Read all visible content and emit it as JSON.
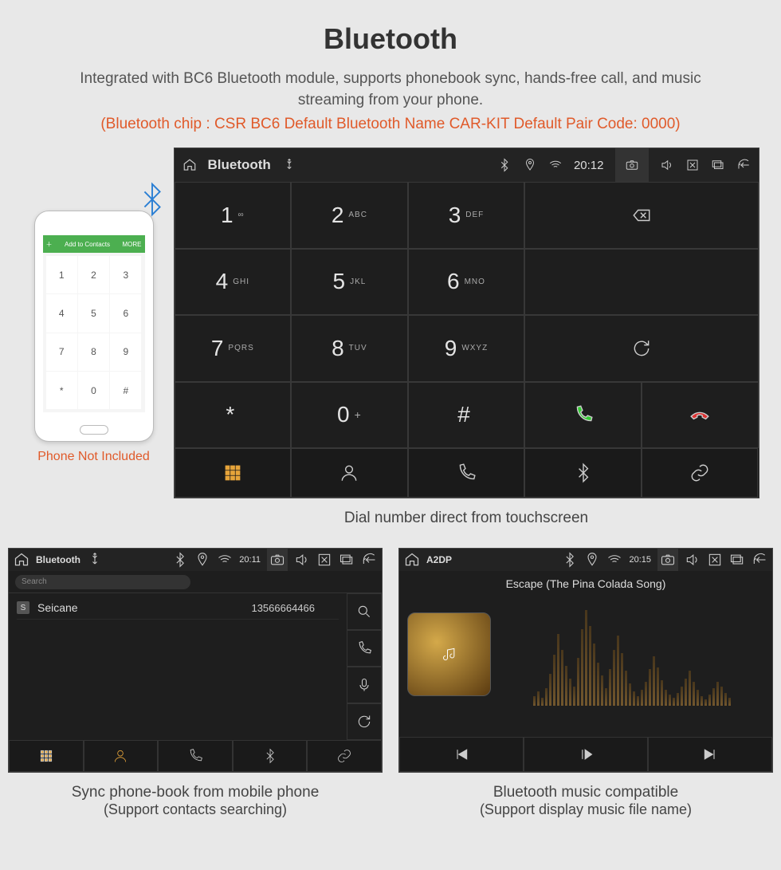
{
  "header": {
    "title": "Bluetooth",
    "subtitle": "Integrated with BC6 Bluetooth module, supports phonebook sync, hands-free call, and music streaming from your phone.",
    "specs": "(Bluetooth chip : CSR BC6     Default Bluetooth Name CAR-KIT     Default Pair Code: 0000)"
  },
  "phone": {
    "top_label": "Add to Contacts",
    "top_right": "MORE",
    "keys": [
      "1",
      "2",
      "3",
      "4",
      "5",
      "6",
      "7",
      "8",
      "9",
      "*",
      "0",
      "#"
    ],
    "caption": "Phone Not Included"
  },
  "dialer": {
    "statusbar": {
      "title": "Bluetooth",
      "time": "20:12"
    },
    "keys": [
      {
        "d": "1",
        "s": "∞"
      },
      {
        "d": "2",
        "s": "ABC"
      },
      {
        "d": "3",
        "s": "DEF"
      },
      {
        "d": "4",
        "s": "GHI"
      },
      {
        "d": "5",
        "s": "JKL"
      },
      {
        "d": "6",
        "s": "MNO"
      },
      {
        "d": "7",
        "s": "PQRS"
      },
      {
        "d": "8",
        "s": "TUV"
      },
      {
        "d": "9",
        "s": "WXYZ"
      },
      {
        "d": "*",
        "s": ""
      },
      {
        "d": "0",
        "s": "+"
      },
      {
        "d": "#",
        "s": ""
      }
    ],
    "caption": "Dial number direct from touchscreen"
  },
  "contacts": {
    "statusbar": {
      "title": "Bluetooth",
      "time": "20:11"
    },
    "search_placeholder": "Search",
    "badge": "S",
    "name": "Seicane",
    "number": "13566664466",
    "caption1": "Sync phone-book from mobile phone",
    "caption2": "(Support contacts searching)"
  },
  "music": {
    "statusbar": {
      "title": "A2DP",
      "time": "20:15"
    },
    "song": "Escape (The Pina Colada Song)",
    "caption1": "Bluetooth music compatible",
    "caption2": "(Support display music file name)"
  }
}
